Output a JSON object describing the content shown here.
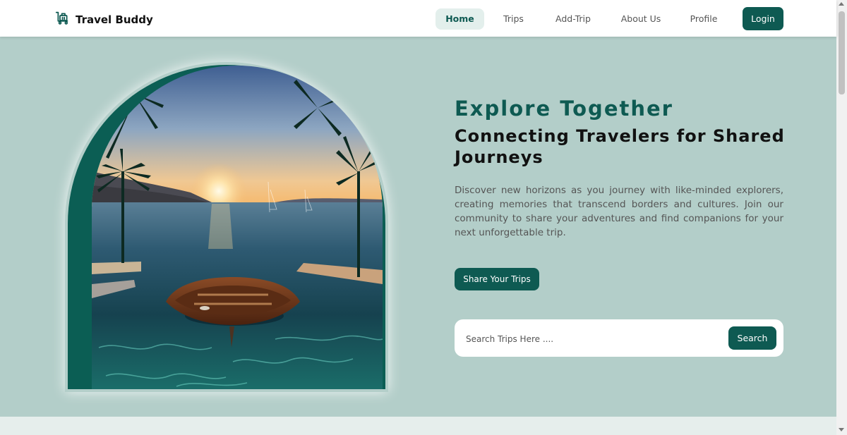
{
  "brand": {
    "name": "Travel Buddy",
    "icon": "luggage-cart-icon"
  },
  "nav": {
    "links": [
      {
        "label": "Home",
        "active": true
      },
      {
        "label": "Trips"
      },
      {
        "label": "Add-Trip"
      },
      {
        "label": "About Us"
      },
      {
        "label": "Profile"
      }
    ],
    "login_label": "Login"
  },
  "hero": {
    "title": "Explore Together",
    "subtitle": "Connecting Travelers for Shared Journeys",
    "description": "Discover new horizons as you journey with like-minded explorers, creating memories that transcend borders and cultures. Join our community to share your adventures and find companions for your next unforgettable trip.",
    "cta_label": "Share Your Trips",
    "image": "sunset-sea-boat-palm-trees"
  },
  "search": {
    "placeholder": "Search Trips Here ....",
    "button_label": "Search"
  },
  "colors": {
    "accent": "#0e5a52",
    "hero_bg": "#b3cec9",
    "nav_active_bg": "#e3efec"
  }
}
